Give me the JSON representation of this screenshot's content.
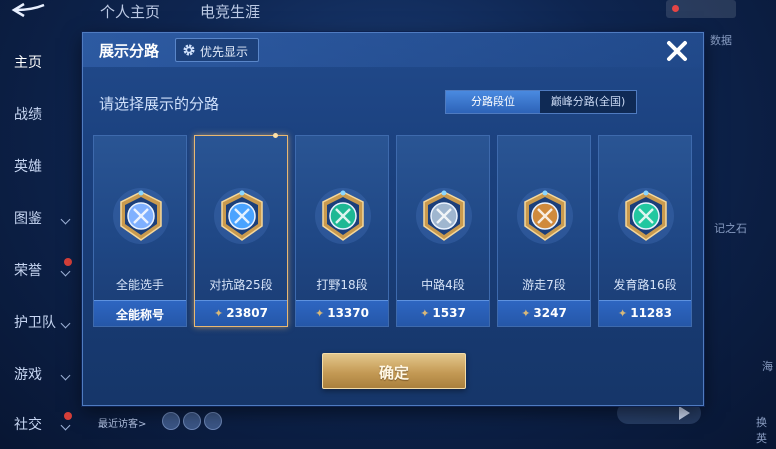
{
  "background": {
    "top_tabs": [
      "个人主页",
      "电竞生涯"
    ],
    "sidebar": [
      {
        "label": "主页",
        "chevron": false,
        "badge": false
      },
      {
        "label": "战绩",
        "chevron": false,
        "badge": false
      },
      {
        "label": "英雄",
        "chevron": false,
        "badge": false
      },
      {
        "label": "图鉴",
        "chevron": true,
        "badge": false
      },
      {
        "label": "荣誉",
        "chevron": true,
        "badge": true
      },
      {
        "label": "护卫队",
        "chevron": true,
        "badge": false
      },
      {
        "label": "游戏",
        "chevron": true,
        "badge": false
      },
      {
        "label": "社交",
        "chevron": true,
        "badge": true
      }
    ],
    "recent_visitors": "最近访客>",
    "right_texts": [
      "数据",
      "记之石",
      "海",
      "换英"
    ]
  },
  "dialog": {
    "title": "展示分路",
    "priority_label": "优先显示",
    "prompt": "请选择展示的分路",
    "segments": [
      "分路段位",
      "巅峰分路(全国)"
    ],
    "active_segment": 0,
    "confirm_label": "确定",
    "selected_index": 1
  },
  "cards": [
    {
      "name": "全能选手",
      "score": "全能称号",
      "emblem": "all-round-emblem-icon",
      "accent": "#7fb0ff",
      "has_wing": false
    },
    {
      "name": "对抗路25段",
      "score": "23807",
      "emblem": "clash-lane-emblem-icon",
      "accent": "#4aa3ff",
      "has_wing": true
    },
    {
      "name": "打野18段",
      "score": "13370",
      "emblem": "jungle-emblem-icon",
      "accent": "#1fb894",
      "has_wing": true
    },
    {
      "name": "中路4段",
      "score": "1537",
      "emblem": "mid-lane-emblem-icon",
      "accent": "#9fb6cf",
      "has_wing": true
    },
    {
      "name": "游走7段",
      "score": "3247",
      "emblem": "roam-emblem-icon",
      "accent": "#d08a3c",
      "has_wing": true
    },
    {
      "name": "发育路16段",
      "score": "11283",
      "emblem": "farm-lane-emblem-icon",
      "accent": "#22c7a0",
      "has_wing": true
    }
  ]
}
